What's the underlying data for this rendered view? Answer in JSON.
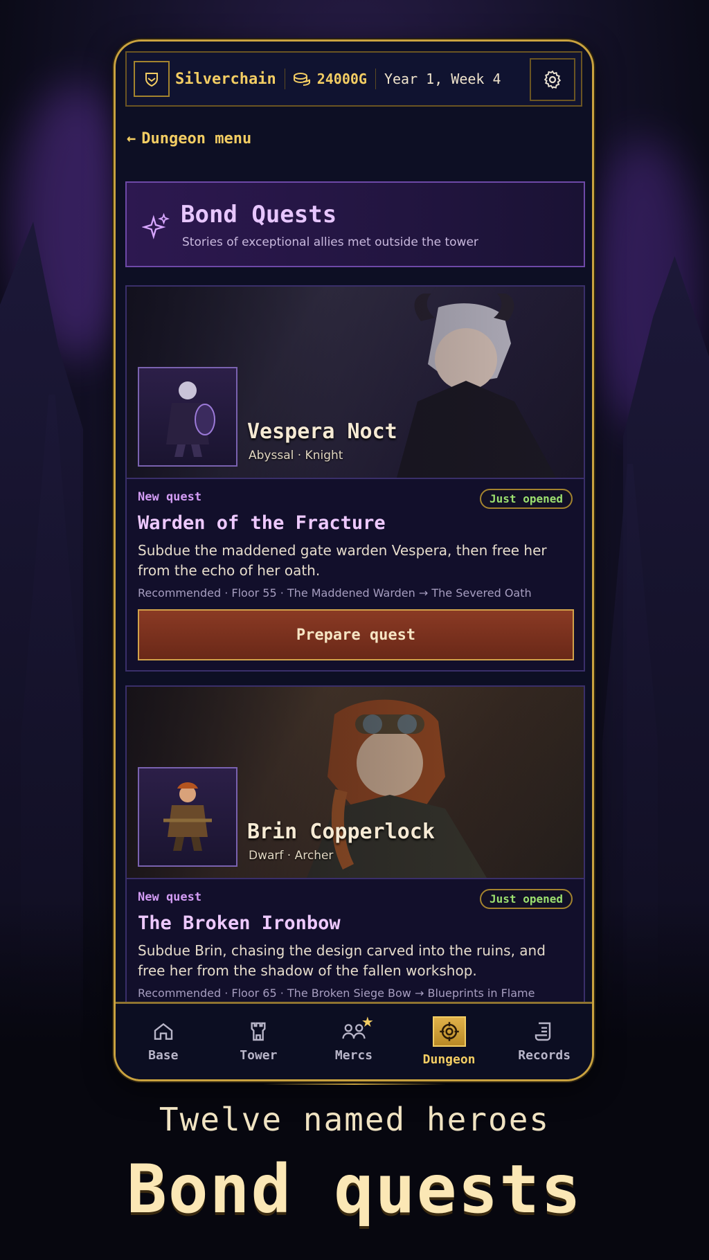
{
  "header": {
    "guild_name": "Silverchain",
    "gold": "24000G",
    "date": "Year 1, Week 4"
  },
  "back_label": "Dungeon menu",
  "banner": {
    "title": "Bond Quests",
    "subtitle": "Stories of exceptional allies met outside the tower"
  },
  "quests": [
    {
      "hero_name": "Vespera Noct",
      "hero_sub": "Abyssal · Knight",
      "tag": "New quest",
      "badge": "Just opened",
      "title": "Warden of the Fracture",
      "description": "Subdue the maddened gate warden Vespera, then free her from the echo of her oath.",
      "recommended": "Recommended · Floor 55 · The Maddened Warden → The Severed Oath",
      "button": "Prepare quest"
    },
    {
      "hero_name": "Brin Copperlock",
      "hero_sub": "Dwarf · Archer",
      "tag": "New quest",
      "badge": "Just opened",
      "title": "The Broken Ironbow",
      "description": "Subdue Brin, chasing the design carved into the ruins, and free her from the shadow of the fallen workshop.",
      "recommended": "Recommended · Floor 65 · The Broken Siege Bow → Blueprints in Flame"
    }
  ],
  "nav": [
    {
      "label": "Base",
      "icon": "home-icon"
    },
    {
      "label": "Tower",
      "icon": "tower-icon"
    },
    {
      "label": "Mercs",
      "icon": "people-icon"
    },
    {
      "label": "Dungeon",
      "icon": "target-icon",
      "active": true
    },
    {
      "label": "Records",
      "icon": "scroll-icon"
    }
  ],
  "caption": {
    "line1": "Twelve named heroes",
    "line2": "Bond quests"
  },
  "colors": {
    "gold_accent": "#f3cd63",
    "purple_accent": "#e7c6ff",
    "badge_green": "#9ce06f",
    "button_rust": "#7a301e"
  }
}
